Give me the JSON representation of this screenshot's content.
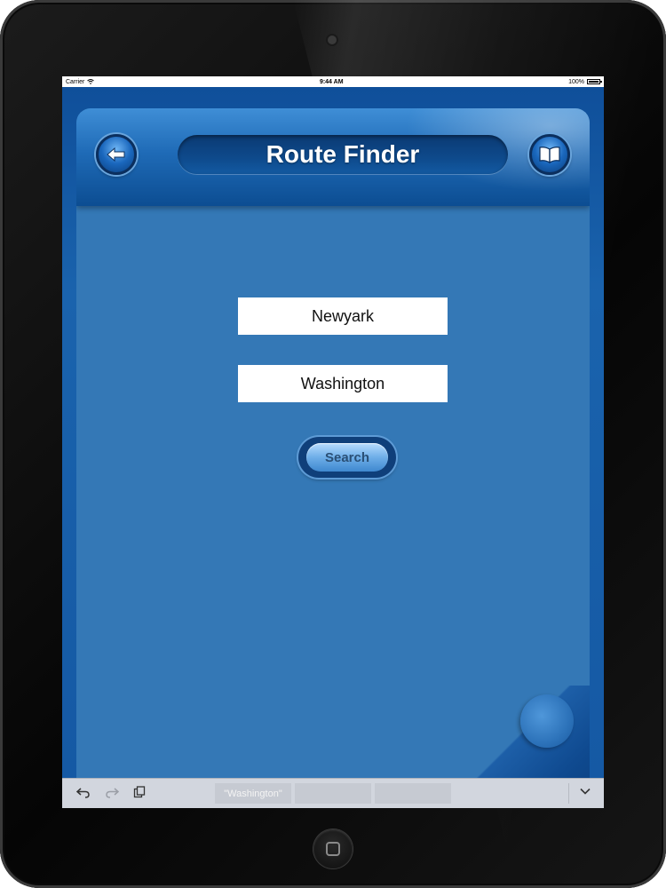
{
  "status_bar": {
    "carrier": "Carrier",
    "time": "9:44 AM",
    "battery": "100%",
    "battery_level": 1.0
  },
  "header": {
    "title": "Route Finder",
    "back_icon": "arrow-left-icon",
    "menu_icon": "book-icon"
  },
  "form": {
    "from_value": "Newyark",
    "to_value": "Washington",
    "search_label": "Search"
  },
  "keyboard_bar": {
    "suggestions": [
      "\"Washington\"",
      "",
      ""
    ],
    "icons": [
      "undo-icon",
      "redo-icon",
      "paste-icon",
      "chevron-down-icon"
    ]
  },
  "colors": {
    "accent": "#2f74b4",
    "header": "#0c4d92",
    "button": "#6eaee8"
  }
}
